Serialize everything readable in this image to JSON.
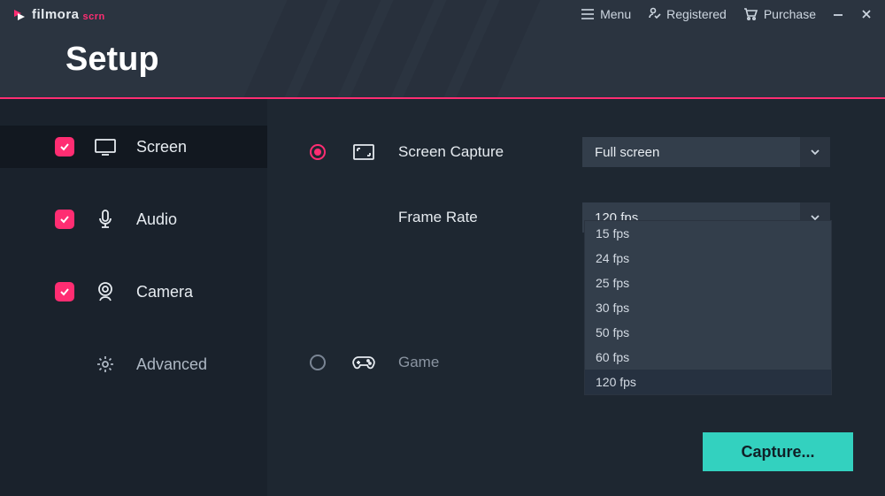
{
  "brand": {
    "name": "filmora",
    "suffix": "scrn"
  },
  "titlebar": {
    "menu": "Menu",
    "registered": "Registered",
    "purchase": "Purchase"
  },
  "page_title": "Setup",
  "sidebar": {
    "screen": {
      "label": "Screen",
      "checked": true
    },
    "audio": {
      "label": "Audio",
      "checked": true
    },
    "camera": {
      "label": "Camera",
      "checked": true
    },
    "advanced": {
      "label": "Advanced"
    }
  },
  "content": {
    "screen_capture": {
      "label": "Screen Capture",
      "select_value": "Full screen"
    },
    "frame_rate": {
      "label": "Frame Rate",
      "select_value": "120 fps",
      "options": [
        "15 fps",
        "24 fps",
        "25 fps",
        "30 fps",
        "50 fps",
        "60 fps",
        "120 fps"
      ],
      "selected_option": "120 fps"
    },
    "game": {
      "label": "Game"
    }
  },
  "capture_button": "Capture..."
}
